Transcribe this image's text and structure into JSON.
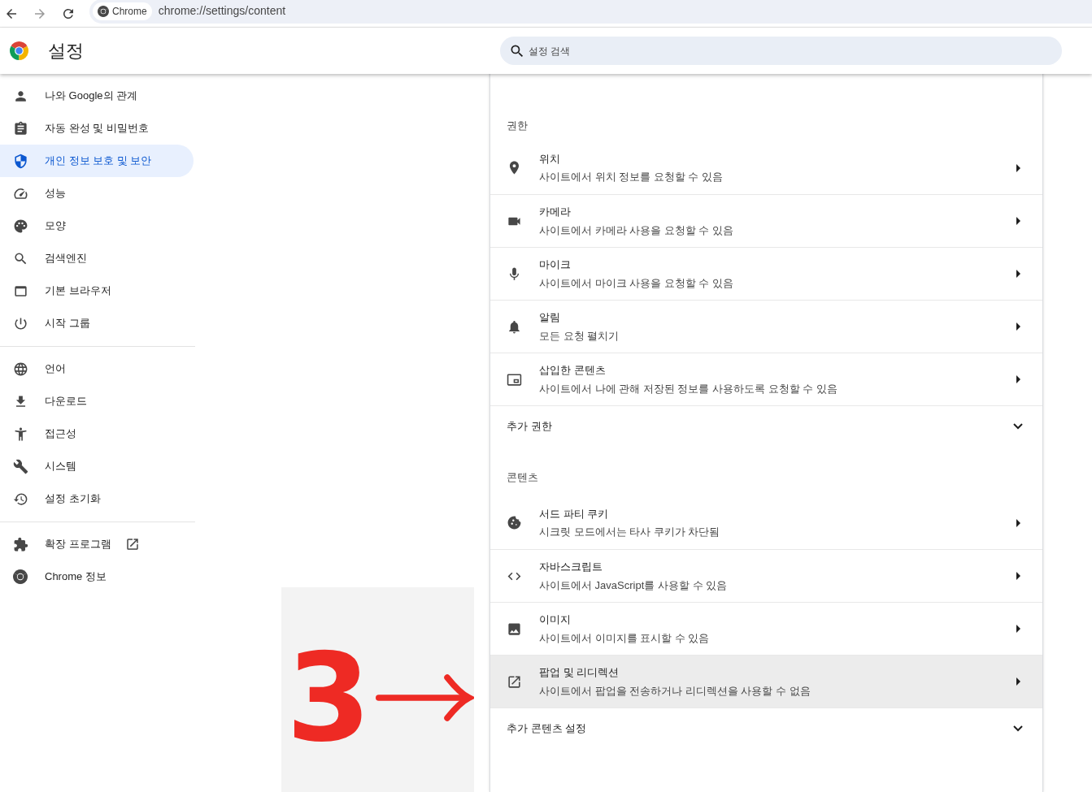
{
  "browser": {
    "chip": "Chrome",
    "url": "chrome://settings/content"
  },
  "header": {
    "title": "설정",
    "search": {
      "placeholder": "설정 검색"
    }
  },
  "sidebar": {
    "groups": [
      [
        {
          "label": "나와 Google의 관계",
          "selected": false,
          "external": false
        },
        {
          "label": "자동 완성 및 비밀번호",
          "selected": false,
          "external": false
        },
        {
          "label": "개인 정보 보호 및 보안",
          "selected": true,
          "external": false
        },
        {
          "label": "성능",
          "selected": false,
          "external": false
        },
        {
          "label": "모양",
          "selected": false,
          "external": false
        },
        {
          "label": "검색엔진",
          "selected": false,
          "external": false
        },
        {
          "label": "기본 브라우저",
          "selected": false,
          "external": false
        },
        {
          "label": "시작 그룹",
          "selected": false,
          "external": false
        }
      ],
      [
        {
          "label": "언어",
          "selected": false,
          "external": false
        },
        {
          "label": "다운로드",
          "selected": false,
          "external": false
        },
        {
          "label": "접근성",
          "selected": false,
          "external": false
        },
        {
          "label": "시스템",
          "selected": false,
          "external": false
        },
        {
          "label": "설정 초기화",
          "selected": false,
          "external": false
        }
      ],
      [
        {
          "label": "확장 프로그램",
          "selected": false,
          "external": true
        },
        {
          "label": "Chrome 정보",
          "selected": false,
          "external": false
        }
      ]
    ]
  },
  "sections": [
    {
      "heading": "권한",
      "rows": [
        {
          "title": "위치",
          "subtitle": "사이트에서 위치 정보를 요청할 수 있음",
          "highlighted": false
        },
        {
          "title": "카메라",
          "subtitle": "사이트에서 카메라 사용을 요청할 수 있음",
          "highlighted": false
        },
        {
          "title": "마이크",
          "subtitle": "사이트에서 마이크 사용을 요청할 수 있음",
          "highlighted": false
        },
        {
          "title": "알림",
          "subtitle": "모든 요청 펼치기",
          "highlighted": false
        },
        {
          "title": "삽입한 콘텐츠",
          "subtitle": "사이트에서 나에 관해 저장된 정보를 사용하도록 요청할 수 있음",
          "highlighted": false
        }
      ],
      "more": {
        "label": "추가 권한",
        "expanded": false
      }
    },
    {
      "heading": "콘텐츠",
      "rows": [
        {
          "title": "서드 파티 쿠키",
          "subtitle": "시크릿 모드에서는 타사 쿠키가 차단됨",
          "highlighted": false
        },
        {
          "title": "자바스크립트",
          "subtitle": "사이트에서 JavaScript를 사용할 수 있음",
          "highlighted": false
        },
        {
          "title": "이미지",
          "subtitle": "사이트에서 이미지를 표시할 수 있음",
          "highlighted": false
        },
        {
          "title": "팝업 및 리디렉션",
          "subtitle": "사이트에서 팝업을 전송하거나 리디렉션을 사용할 수 없음",
          "highlighted": true
        }
      ],
      "more": {
        "label": "추가 콘텐츠 설정",
        "expanded": false
      }
    }
  ],
  "annotation": {
    "number": "3"
  }
}
